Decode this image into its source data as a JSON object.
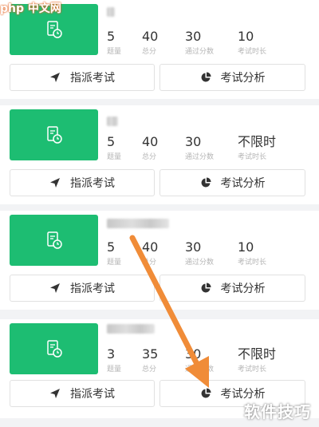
{
  "watermarks": {
    "logo": "php 中文网",
    "brand": "软件技巧"
  },
  "colors": {
    "accent": "#1dbd72",
    "arrow": "#f08c38",
    "background": "#f2f3f5"
  },
  "exams": [
    {
      "stats": [
        {
          "value": "5",
          "label": "题量"
        },
        {
          "value": "40",
          "label": "总分"
        },
        {
          "value": "30",
          "label": "通过分数"
        },
        {
          "value": "10",
          "label": "考试时长"
        }
      ],
      "assign_label": "指派考试",
      "analysis_label": "考试分析"
    },
    {
      "stats": [
        {
          "value": "5",
          "label": "题量"
        },
        {
          "value": "40",
          "label": "总分"
        },
        {
          "value": "30",
          "label": "通过分数"
        },
        {
          "value": "不限时",
          "label": "考试时长"
        }
      ],
      "assign_label": "指派考试",
      "analysis_label": "考试分析"
    },
    {
      "stats": [
        {
          "value": "5",
          "label": "题量"
        },
        {
          "value": "40",
          "label": "总分"
        },
        {
          "value": "30",
          "label": "通过分数"
        },
        {
          "value": "10",
          "label": "考试时长"
        }
      ],
      "assign_label": "指派考试",
      "analysis_label": "考试分析"
    },
    {
      "stats": [
        {
          "value": "3",
          "label": "题量"
        },
        {
          "value": "35",
          "label": "总分"
        },
        {
          "value": "30",
          "label": "通过分数"
        },
        {
          "value": "不限时",
          "label": "考试时长"
        }
      ],
      "assign_label": "指派考试",
      "analysis_label": "考试分析"
    }
  ],
  "icons": {
    "thumbnail": "exam-paper-clock-icon",
    "assign": "send-plane-icon",
    "analysis": "pie-chart-icon"
  }
}
